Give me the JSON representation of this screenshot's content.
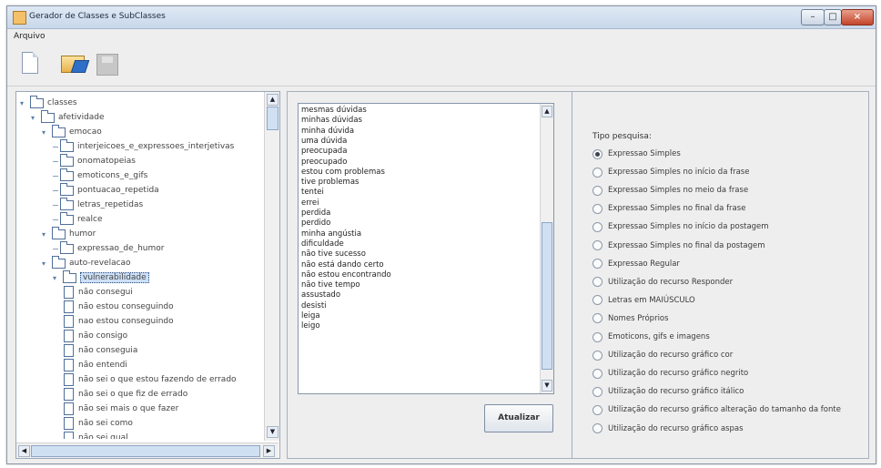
{
  "window": {
    "title": "Gerador de Classes e SubClasses",
    "controls": {
      "minimize": "–",
      "maximize": "□",
      "close": "×"
    }
  },
  "menu": {
    "items": [
      "Arquivo"
    ]
  },
  "toolbar": {
    "buttons": [
      "new-file-icon",
      "open-folder-icon",
      "save-disk-icon"
    ]
  },
  "tree": {
    "nodes": [
      {
        "label": "classes",
        "level": 0,
        "type": "folder",
        "expanded": true
      },
      {
        "label": "afetividade",
        "level": 1,
        "type": "folder",
        "expanded": true
      },
      {
        "label": "emocao",
        "level": 2,
        "type": "folder",
        "expanded": true
      },
      {
        "label": "interjeicoes_e_expressoes_interjetivas",
        "level": 3,
        "type": "folder",
        "expanded": false
      },
      {
        "label": "onomatopeias",
        "level": 3,
        "type": "folder",
        "expanded": false
      },
      {
        "label": "emoticons_e_gifs",
        "level": 3,
        "type": "folder",
        "expanded": false
      },
      {
        "label": "pontuacao_repetida",
        "level": 3,
        "type": "folder",
        "expanded": false
      },
      {
        "label": "letras_repetidas",
        "level": 3,
        "type": "folder",
        "expanded": false
      },
      {
        "label": "realce",
        "level": 3,
        "type": "folder",
        "expanded": false
      },
      {
        "label": "humor",
        "level": 2,
        "type": "folder",
        "expanded": true
      },
      {
        "label": "expressao_de_humor",
        "level": 3,
        "type": "folder",
        "expanded": false
      },
      {
        "label": "auto-revelacao",
        "level": 2,
        "type": "folder",
        "expanded": true
      },
      {
        "label": "vulnerabilidade",
        "level": 3,
        "type": "folder",
        "expanded": true,
        "selected": true
      },
      {
        "label": "não consegui",
        "level": 4,
        "type": "leaf"
      },
      {
        "label": "não estou conseguindo",
        "level": 4,
        "type": "leaf"
      },
      {
        "label": "nao estou conseguindo",
        "level": 4,
        "type": "leaf"
      },
      {
        "label": "não consigo",
        "level": 4,
        "type": "leaf"
      },
      {
        "label": "não conseguia",
        "level": 4,
        "type": "leaf"
      },
      {
        "label": "não entendi",
        "level": 4,
        "type": "leaf"
      },
      {
        "label": "não sei o que estou fazendo de errado",
        "level": 4,
        "type": "leaf"
      },
      {
        "label": "não sei o que fiz de errado",
        "level": 4,
        "type": "leaf"
      },
      {
        "label": "não sei mais o que fazer",
        "level": 4,
        "type": "leaf"
      },
      {
        "label": "não sei como",
        "level": 4,
        "type": "leaf"
      },
      {
        "label": "não sei qual",
        "level": 4,
        "type": "leaf"
      }
    ]
  },
  "list": {
    "items": [
      "mesmas dúvidas",
      "minhas dúvidas",
      "minha dúvida",
      "uma dúvida",
      "preocupada",
      "preocupado",
      "estou com problemas",
      "tive problemas",
      "tentei",
      "errei",
      "perdida",
      "perdido",
      "minha angústia",
      "dificuldade",
      "não tive sucesso",
      "não está dando certo",
      "não estou encontrando",
      "não tive tempo",
      "assustado",
      "desisti",
      "leiga",
      "leigo"
    ]
  },
  "buttons": {
    "atualizar": "Atualizar"
  },
  "search": {
    "label": "Tipo pesquisa:",
    "selected_index": 0,
    "options": [
      "Expressao Simples",
      "Expressao Simples no início da frase",
      "Expressao Simples no meio da frase",
      "Expressao Simples no final da frase",
      "Expressao Simples no início da postagem",
      "Expressao Simples no final da postagem",
      "Expressao Regular",
      "Utilização do recurso Responder",
      "Letras em MAIÚSCULO",
      "Nomes Próprios",
      "Emoticons, gifs e imagens",
      "Utilização do recurso gráfico cor",
      "Utilização do recurso gráfico negrito",
      "Utilização do recurso gráfico itálico",
      "Utilização do recurso gráfico alteração do tamanho da fonte",
      "Utilização do recurso gráfico aspas"
    ]
  }
}
